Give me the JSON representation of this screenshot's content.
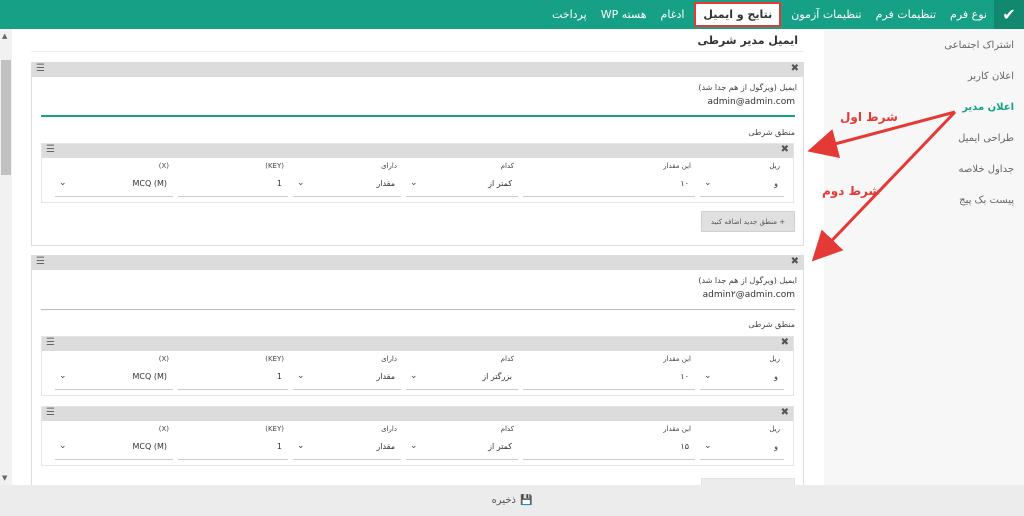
{
  "nav": {
    "tabs": [
      "نوع فرم",
      "تنظیمات فرم",
      "تنظیمات آزمون",
      "نتایج و ایمیل",
      "ادغام",
      "هسته WP",
      "پرداخت"
    ],
    "active_tab": "نتایج و ایمیل"
  },
  "sidebar": {
    "items": [
      "اشتراک اجتماعی",
      "اعلان کاربر",
      "اعلان مدیر",
      "طراحی ایمیل",
      "جداول خلاصه",
      "پیست بک پیج"
    ],
    "active_item": "اعلان مدیر"
  },
  "main": {
    "heading": "ایمیل مدیر شرطی",
    "panels": [
      {
        "email_label": "ایمیل (ویرگول از هم جدا شد)",
        "email_value": "admin@admin.com",
        "logic_label": "منطق شرطی",
        "rules": [
          {
            "field_labels": [
              "ریل",
              "این مقدار",
              "کدام",
              "دارای",
              "(KEY)",
              "(X)"
            ],
            "field_values": [
              "و",
              "۱۰",
              "کمتر از",
              "مقدار",
              "1",
              "MCQ (M)"
            ]
          }
        ],
        "add_button": "منطق جدید اضافه کنید"
      },
      {
        "email_label": "ایمیل (ویرگول از هم جدا شد)",
        "email_value": "admin۲@admin.com",
        "logic_label": "منطق شرطی",
        "rules": [
          {
            "field_labels": [
              "ریل",
              "این مقدار",
              "کدام",
              "دارای",
              "(KEY)",
              "(X)"
            ],
            "field_values": [
              "و",
              "۱۰",
              "بزرگتر از",
              "مقدار",
              "1",
              "MCQ (M)"
            ]
          },
          {
            "field_labels": [
              "ریل",
              "این مقدار",
              "کدام",
              "دارای",
              "(KEY)",
              "(X)"
            ],
            "field_values": [
              "و",
              "۱۵",
              "کمتر از",
              "مقدار",
              "1",
              "MCQ (M)"
            ]
          }
        ]
      }
    ]
  },
  "annotations": {
    "first": "شرط اول",
    "second": "شرط دوم",
    "color": "#e53935"
  },
  "footer": {
    "save_label": "ذخیره"
  },
  "colors": {
    "accent": "#16a085"
  }
}
